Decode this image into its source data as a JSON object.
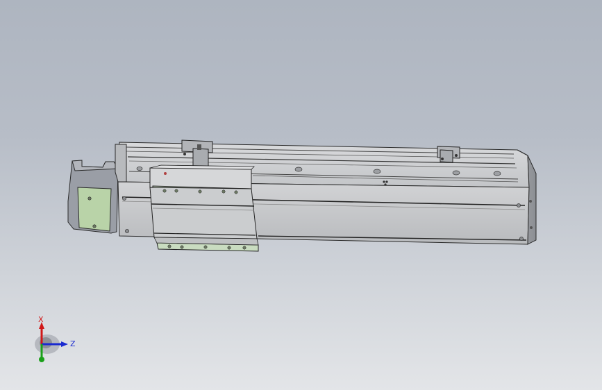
{
  "viewport": {
    "background_top": "#aeb5c0",
    "background_bottom": "#e3e5e8"
  },
  "model": {
    "body_color": "#c5c7c9",
    "edge_color": "#222222",
    "motor_accent": "#b9d3a8",
    "plate_accent": "#c9dcc0"
  },
  "triad": {
    "x_label": "X",
    "z_label": "Z",
    "x_color": "#d01818",
    "z_color": "#1a2ad0",
    "y_color": "#1aa01a"
  }
}
